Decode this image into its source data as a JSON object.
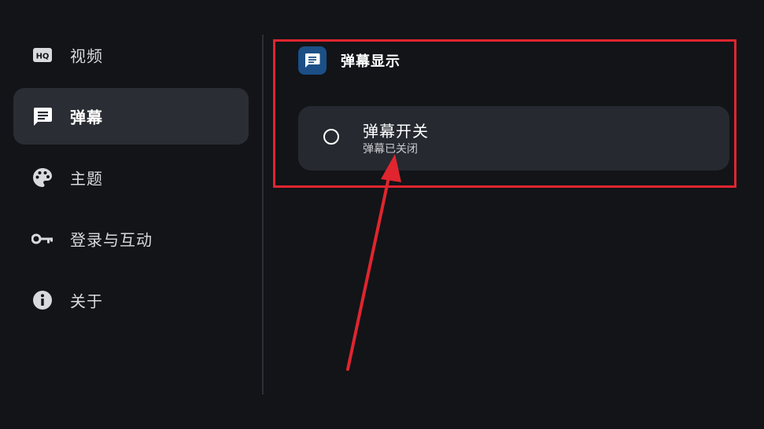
{
  "sidebar": {
    "items": [
      {
        "label": "视频",
        "icon": "hq-video-icon",
        "selected": false
      },
      {
        "label": "弹幕",
        "icon": "danmaku-comment-icon",
        "selected": true
      },
      {
        "label": "主题",
        "icon": "palette-icon",
        "selected": false
      },
      {
        "label": "登录与互动",
        "icon": "key-icon",
        "selected": false
      },
      {
        "label": "关于",
        "icon": "info-icon",
        "selected": false
      }
    ]
  },
  "section": {
    "title": "弹幕显示",
    "icon": "comment-icon"
  },
  "toggle": {
    "title": "弹幕开关",
    "subtitle": "弹幕已关闭",
    "enabled": false
  },
  "colors": {
    "background": "#121418",
    "selected_item": "#2a2d33",
    "card": "#262930",
    "section_icon_bg": "#1b4f86",
    "annotation": "#e0252f"
  }
}
